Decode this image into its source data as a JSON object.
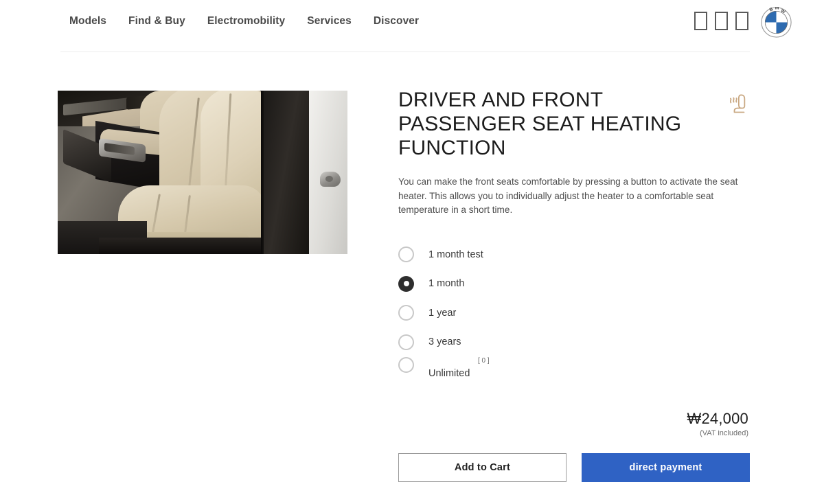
{
  "header": {
    "nav_items": [
      {
        "label": "Models"
      },
      {
        "label": "Find & Buy"
      },
      {
        "label": "Electromobility"
      },
      {
        "label": "Services"
      },
      {
        "label": "Discover"
      }
    ],
    "icons": [
      {
        "name": "missing-glyph-box-1"
      },
      {
        "name": "missing-glyph-box-2"
      },
      {
        "name": "missing-glyph-box-3"
      }
    ],
    "logo_alt": "BMW",
    "logo_letters": "BMW"
  },
  "product": {
    "image_alt": "BMW front seats with beige leather upholstery",
    "title": "DRIVER AND FRONT PASSENGER SEAT HEATING FUNCTION",
    "icon_name": "seat-heating-icon",
    "icon_color": "#c9a882",
    "description": "You can make the front seats comfortable by pressing a button to activate the seat heater. This allows you to individually adjust the heater to a comfortable seat temperature in a short time."
  },
  "options": {
    "items": [
      {
        "label": "1 month test",
        "selected": false
      },
      {
        "label": "1 month",
        "selected": true
      },
      {
        "label": "1 year",
        "selected": false
      },
      {
        "label": "3 years",
        "selected": false
      },
      {
        "label": "Unlimited",
        "selected": false,
        "footnote": "[ 0 ]"
      }
    ]
  },
  "price": {
    "amount": "₩24,000",
    "vat_note": "(VAT included)"
  },
  "actions": {
    "add_to_cart_label": "Add to Cart",
    "direct_payment_label": "direct payment",
    "direct_payment_color": "#2f62c4"
  }
}
